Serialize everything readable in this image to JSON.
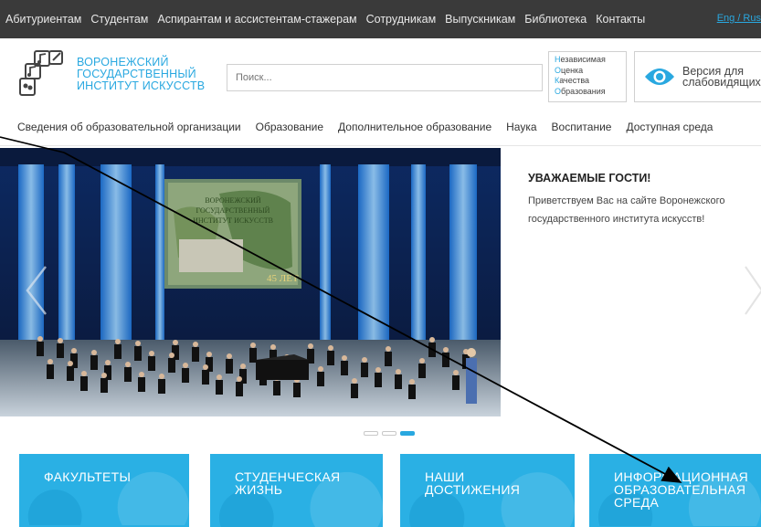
{
  "topbar": {
    "nav": [
      "Абитуриентам",
      "Студентам",
      "Аспирантам и ассистентам-стажерам",
      "Сотрудникам",
      "Выпускникам",
      "Библиотека",
      "Контакты"
    ],
    "lang": "Eng / Rus"
  },
  "header": {
    "logo_lines": [
      "ВОРОНЕЖСКИЙ",
      "ГОСУДАРСТВЕННЫЙ",
      "ИНСТИТУТ ИСКУССТВ"
    ],
    "search_placeholder": "Поиск...",
    "nok": [
      {
        "first": "Н",
        "rest": "езависимая"
      },
      {
        "first": "О",
        "rest": "ценка"
      },
      {
        "first": "К",
        "rest": "ачества"
      },
      {
        "first": "О",
        "rest": "бразования"
      }
    ],
    "vision_lines": [
      "Версия для",
      "слабовидящих"
    ]
  },
  "menu": [
    "Сведения об образовательной организации",
    "Образование",
    "Дополнительное образование",
    "Наука",
    "Воспитание",
    "Доступная среда"
  ],
  "slide": {
    "banner_lines": [
      "ВОРОНЕЖСКИЙ",
      "ГОСУДАРСТВЕННЫЙ",
      "ИНСТИТУТ ИСКУССТВ"
    ],
    "banner_years": "45 ЛЕТ",
    "heading": "УВАЖАЕМЫЕ ГОСТИ!",
    "text": "Приветствуем Вас на сайте Воронежского государственного института искусств!"
  },
  "dots": 3,
  "active_dot": 2,
  "tiles": [
    {
      "lines": [
        "ФАКУЛЬТЕТЫ"
      ]
    },
    {
      "lines": [
        "СТУДЕНЧЕСКАЯ",
        "ЖИЗНЬ"
      ]
    },
    {
      "lines": [
        "НАШИ",
        "ДОСТИЖЕНИЯ"
      ]
    },
    {
      "lines": [
        "ИНФОРМАЦИОННАЯ",
        "ОБРАЗОВАТЕЛЬНАЯ",
        "СРЕДА"
      ]
    }
  ],
  "colors": {
    "accent": "#29a8e0",
    "topbar": "#3a3a3a",
    "tile": "#2ab0e4"
  }
}
